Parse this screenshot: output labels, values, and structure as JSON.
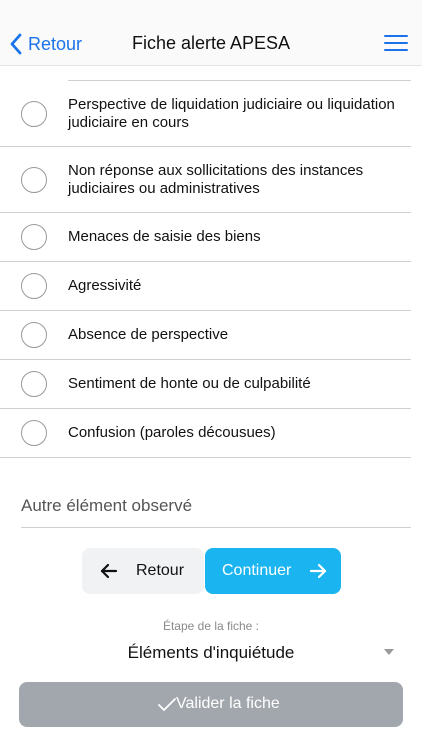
{
  "header": {
    "back_label": "Retour",
    "title": "Fiche alerte APESA",
    "back_icon": "chevron-left-icon",
    "menu_icon": "hamburger-menu-icon"
  },
  "criteria": [
    {
      "label": "Perspective de liquidation judiciaire ou liquidation judiciaire en cours",
      "selected": false
    },
    {
      "label": "Non réponse aux sollicitations des instances judiciaires ou administratives",
      "selected": false
    },
    {
      "label": "Menaces de saisie des biens",
      "selected": false
    },
    {
      "label": "Agressivité",
      "selected": false
    },
    {
      "label": "Absence de perspective",
      "selected": false
    },
    {
      "label": "Sentiment de honte ou de culpabilité",
      "selected": false
    },
    {
      "label": "Confusion (paroles décousues)",
      "selected": false
    }
  ],
  "other_field": {
    "placeholder": "Autre élément observé",
    "value": ""
  },
  "navigation": {
    "back_label": "Retour",
    "continue_label": "Continuer"
  },
  "step": {
    "caption": "Étape de la fiche :",
    "value": "Éléments d'inquiétude"
  },
  "validate": {
    "label": "Valider la fiche"
  },
  "colors": {
    "accent": "#1a73e8",
    "continue_button": "#1ab4f0",
    "validate_button": "#a2a7ae"
  }
}
